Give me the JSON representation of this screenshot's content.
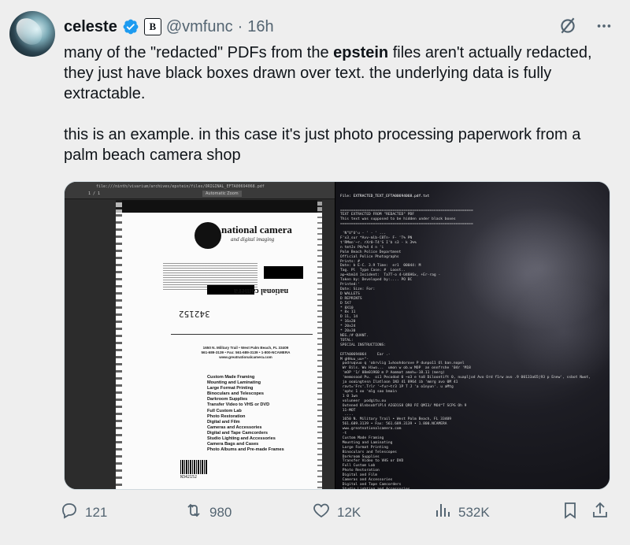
{
  "user": {
    "display_name": "celeste",
    "handle": "@vmfunc",
    "separator": "·",
    "time": "16h",
    "org_badge": "B"
  },
  "tweet": {
    "paragraph1_a": "many of the \"redacted\" PDFs from the ",
    "paragraph1_bold": "epstein",
    "paragraph1_b": " files aren't actually redacted, they just have black boxes drawn over text. the underlying data is fully extractable.",
    "paragraph2": "this is an example. in this case it's just photo processing paperwork from a palm beach camera shop"
  },
  "media": {
    "pdf_url": "file:///ninth/vivarium/archives/epstein/files/ORIGINAL_EFTA00694068.pdf",
    "pdf_pagenum": "1 / 1",
    "pdf_zoom": "Automatic Zoom",
    "logo_name": "national camera",
    "logo_sub": "and digital imaging",
    "mirror_logo": "national camera",
    "stamp_number": "342152",
    "address_line1": "1650 N. Military Trail • West Palm Beach, FL 33409",
    "address_line2": "561-689-3139 • Fax: 561-689-3139 • 1-800-NCAMERA",
    "address_line3": "www.greatnationalcamera.com",
    "services": [
      "Custom Made Framing",
      "Mounting and Laminating",
      "Large Format Printing",
      "Binoculars and Telescopes",
      "Darkroom Supplies",
      "Transfer Video to VHS or DVD",
      "Full Custom Lab",
      "Photo Restoration",
      "Digital and Film",
      "Cameras and Accessories",
      "Digital and Tape Camcorders",
      "Studio Lighting and Accessories",
      "Camera Bags and Cases",
      "Photo Albums and Pre-made Frames"
    ],
    "barcode_number": "N342152",
    "terminal_title": "File: EXTRACTED_TEXT_EFTA00694068.pdf.txt",
    "terminal_lines": [
      "=============================================================",
      "TEXT EXTRACTED FROM \"REDACTED\" PDF",
      "This text was supposed to be hidden under black boxes",
      "=============================================================",
      "",
      " 'N\"U\"U'u - ' - ' ...",
      "F'x3_sur *Avv-mlb-C8Tn- F- 'T% PN",
      "t'RMmn'~r. rXr0-T4'S I'b s3 - k 3%%",
      "n tmtJv P0/%4 4 n 'i",
      "Palm Beach Police Department",
      "Official Police Photographs",
      "Prints: #",
      "Date: b E-C. 3.9 Time:  er1  00044: M",
      "Tag. Pl  Type Case: #  Loost..",
      "ap~kbm14 Incident:  Ta7T-o 4-U46H6x, +Er-rag -",
      "Taken by: Developed by:.... PO BC",
      "Printed:'",
      "Date: Size: For:",
      "D WALLETS",
      "D REPRINTS",
      "D 5X7",
      "* 8X10",
      "* 8x 11",
      "D 11, 14",
      "* 16x20",
      "* 20x24",
      "* 20x30",
      "NEG./# QUANT.",
      "TOTAL:",
      "SPECIAL INSTRUCTIONS:",
      "",
      "EFTA00694064     Ear .-",
      "M gHHuu_uu+\"-",
      " podruqvuo q 'obrvlig 1=hoohdorove P dunpo11 Ol ban.nopel",
      " Wr Bils. Wu Hiwo...  umon w ob.w MOP  an onnfrshe '04r 'M18",
      " 'mOP '1/ 08m01960 m P Aommat amnh=-18.11 (merg)",
      " 'memosood Pu.  oi1 Pecodod 0 ~o3 e to8 Diloontift 0, nuapljod Avo Ord f1rw avo .9 00133a65|93 p Enew', ssbot Nwot,",
      " ja ooaLngtesn Ilatloon 1N3 41 8964 ib 'mmrg avo 0M 41",
      " ravt='Frs'.Trlr '~fur~tr3 1P T J 'a o1nyun'. u aMtg",
      " 'ophc 1 oo 'mlg sao bmain",
      " 1 0 1wn",
      " voluneer  podgitu.ou",
      " Outened 8lnbsobflPl4 AIGD1S8 QRO PZ QMI3/ MO4^T SCPG Oh 9",
      " 11-MOT",
      "  ....",
      " 1650 N. Military Trail • West Palm Beach, FL 33409",
      " 561.689.3139 • Fax: 561.689.3139 • 1.800.NCAMERA",
      " www.greatnationalcamera.com",
      " -t",
      " Custom Made Framing",
      " Mounting and Laminating",
      " Large Format Printing",
      " Binoculars and Telescopes",
      " Darkroom Supplies",
      " Transfer Video to VHS or DVD",
      " Full Custom Lab",
      " Photo Restoration",
      " Digital and Film",
      " Cameras and Accessories",
      " Digital and Tape Camcorders",
      " Studio Lighting and Accessories",
      " Camera Bags and Cases",
      " Photo Albums and Pre-made Frames",
      " EFTA00694064TETEM",
      " D01 MOT"
    ]
  },
  "actions": {
    "replies": "121",
    "reposts": "980",
    "likes": "12K",
    "views": "532K"
  },
  "icons": {
    "verified": "verified-check-icon",
    "grok": "grok-slash-icon",
    "more": "more-dots-icon",
    "reply": "reply-bubble-icon",
    "repost": "repost-arrows-icon",
    "like": "heart-icon",
    "views": "views-bars-icon",
    "bookmark": "bookmark-icon",
    "share": "share-icon"
  },
  "colors": {
    "background": "#eeeeee",
    "verified_blue": "#1d9bf0",
    "secondary_text": "#536471"
  }
}
